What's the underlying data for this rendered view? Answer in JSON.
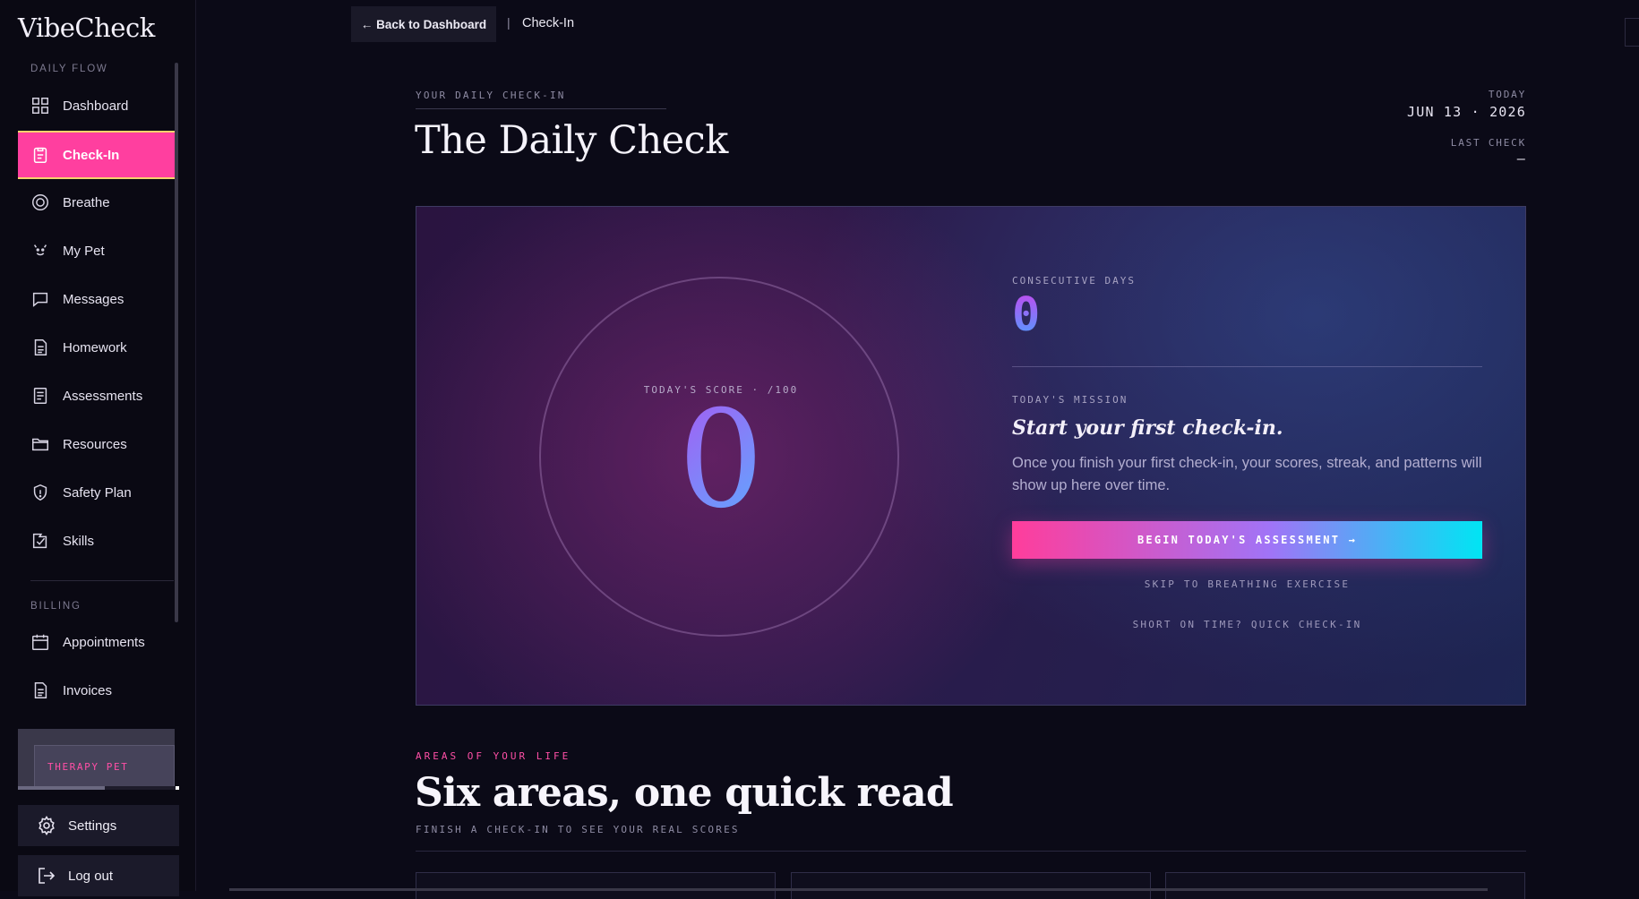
{
  "app": {
    "logo": "VibeCheck"
  },
  "sidebar": {
    "sections": [
      {
        "label": "DAILY FLOW"
      },
      {
        "label": "BILLING"
      }
    ],
    "daily_items": [
      {
        "label": "Dashboard",
        "icon": "grid-icon"
      },
      {
        "label": "Check-In",
        "icon": "clipboard-icon",
        "active": true
      },
      {
        "label": "Breathe",
        "icon": "breathe-circle-icon"
      },
      {
        "label": "My Pet",
        "icon": "pet-face-icon"
      },
      {
        "label": "Messages",
        "icon": "message-icon"
      },
      {
        "label": "Homework",
        "icon": "document-icon"
      },
      {
        "label": "Assessments",
        "icon": "checklist-icon"
      },
      {
        "label": "Resources",
        "icon": "folder-icon"
      },
      {
        "label": "Safety Plan",
        "icon": "shield-icon"
      },
      {
        "label": "Skills",
        "icon": "skills-icon"
      }
    ],
    "billing_items": [
      {
        "label": "Appointments",
        "icon": "calendar-icon"
      },
      {
        "label": "Invoices",
        "icon": "invoice-icon"
      }
    ],
    "pet_card": {
      "label": "THERAPY PET"
    },
    "settings_label": "Settings",
    "logout_label": "Log out"
  },
  "topbar": {
    "back_label": "← Back to Dashboard",
    "separator": "|",
    "current": "Check-In"
  },
  "header": {
    "eyebrow": "YOUR DAILY CHECK-IN",
    "title": "The Daily Check",
    "today_label": "TODAY",
    "today_value": "JUN 13 · 2026",
    "last_label": "LAST CHECK",
    "last_value": "—"
  },
  "hero": {
    "score_label": "TODAY'S SCORE · /100",
    "score_value": "0",
    "streak_label": "CONSECUTIVE DAYS",
    "streak_value": "0",
    "mission_label": "TODAY'S MISSION",
    "mission_title": "Start your first check-in.",
    "mission_desc": "Once you finish your first check-in, your scores, streak, and patterns will show up here over time.",
    "begin_label": "BEGIN TODAY'S ASSESSMENT →",
    "skip_label": "SKIP TO BREATHING EXERCISE",
    "quick_label": "SHORT ON TIME? QUICK CHECK-IN"
  },
  "areas": {
    "eyebrow": "AREAS OF YOUR LIFE",
    "title": "Six areas, one quick read",
    "subtitle": "FINISH A CHECK-IN TO SEE YOUR REAL SCORES"
  },
  "colors": {
    "accent_pink": "#ff3f9f",
    "accent_cyan": "#00e5f3",
    "background": "#0b0a17"
  }
}
